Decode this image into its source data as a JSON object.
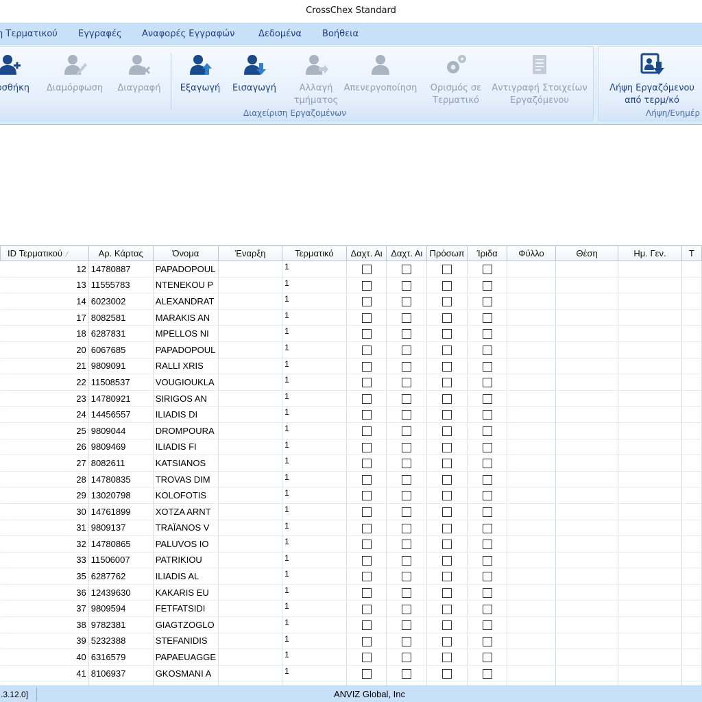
{
  "window": {
    "title": "CrossChex Standard"
  },
  "menu": [
    {
      "label": "η Τερματικού",
      "name": "menu-terminal"
    },
    {
      "label": "Εγγραφές",
      "name": "menu-records"
    },
    {
      "label": "Αναφορές Εγγραφών",
      "name": "menu-reports"
    },
    {
      "label": "Δεδομένα",
      "name": "menu-data"
    },
    {
      "label": "Βοήθεια",
      "name": "menu-help"
    }
  ],
  "ribbon": {
    "employee_group": {
      "label": "Διαχείριση Εργαζομένων",
      "buttons": {
        "add": {
          "label": "οσθήκη",
          "icon": "add-user-icon"
        },
        "modify": {
          "label": "Διαμόρφωση",
          "icon": "edit-user-icon"
        },
        "delete": {
          "label": "Διαγραφή",
          "icon": "delete-user-icon"
        },
        "export": {
          "label": "Εξαγωγή",
          "icon": "export-user-icon"
        },
        "import": {
          "label": "Εισαγωγή",
          "icon": "import-user-icon"
        },
        "change_dept": {
          "line1": "Αλλαγή",
          "line2": "τμήματος",
          "icon": "change-department-icon"
        },
        "deactivate": {
          "label": "Απενεργοποίηση",
          "icon": "deactivate-user-icon"
        },
        "set_terminal": {
          "line1": "Ορισμός σε",
          "line2": "Τερματικό",
          "icon": "gears-icon"
        },
        "copy_data": {
          "line1": "Αντιγραφή Στοιχείων",
          "line2": "Εργαζόμενου",
          "icon": "copy-document-icon"
        }
      }
    },
    "download_group": {
      "label": "Λήψη/Ενημέρ",
      "buttons": {
        "download_employee": {
          "line1": "Λήψη Εργαζόμενου",
          "line2": "από τερμ/κό",
          "icon": "download-from-terminal-icon"
        }
      }
    }
  },
  "colors": {
    "menubar_bg": "#c9e1f8",
    "ribbon_active_icon": "#1b4a8c",
    "ribbon_disabled_icon": "#a9b4c1",
    "statusbar_bg": "#c9e1f8"
  },
  "table": {
    "columns": [
      "ID Τερματικού",
      "Αρ. Κάρτας",
      "Όνομα",
      "Έναρξη",
      "Τερματικό",
      "Δαχτ. Αι",
      "Δαχτ. Αι",
      "Πρόσωπ",
      "Ίριδα",
      "Φύλλο",
      "Θέση",
      "Ημ. Γεν.",
      "Τ"
    ],
    "rows": [
      {
        "id": "12",
        "card": "14780887",
        "name": "PAPADOPOUL",
        "start": "",
        "terminal": "1"
      },
      {
        "id": "13",
        "card": "11555783",
        "name": "NTENEKOU P",
        "start": "",
        "terminal": "1"
      },
      {
        "id": "14",
        "card": "6023002",
        "name": "ALEXANDRAT",
        "start": "",
        "terminal": "1"
      },
      {
        "id": "17",
        "card": "8082581",
        "name": "MARAKIS AN",
        "start": "",
        "terminal": "1"
      },
      {
        "id": "18",
        "card": "6287831",
        "name": "MPELLOS NI",
        "start": "",
        "terminal": "1"
      },
      {
        "id": "20",
        "card": "6067685",
        "name": "PAPADOPOUL",
        "start": "",
        "terminal": "1"
      },
      {
        "id": "21",
        "card": "9809091",
        "name": "RALLI XRIS",
        "start": "",
        "terminal": "1"
      },
      {
        "id": "22",
        "card": "11508537",
        "name": "VOUGIOUKLA",
        "start": "",
        "terminal": "1"
      },
      {
        "id": "23",
        "card": "14780921",
        "name": "SIRIGOS AN",
        "start": "",
        "terminal": "1"
      },
      {
        "id": "24",
        "card": "14456557",
        "name": "ILIADIS DI",
        "start": "",
        "terminal": "1"
      },
      {
        "id": "25",
        "card": "9809044",
        "name": "DROMPOURA",
        "start": "",
        "terminal": "1"
      },
      {
        "id": "26",
        "card": "9809469",
        "name": "ILIADIS FI",
        "start": "",
        "terminal": "1"
      },
      {
        "id": "27",
        "card": "8082611",
        "name": "KATSIANOS",
        "start": "",
        "terminal": "1"
      },
      {
        "id": "28",
        "card": "14780835",
        "name": "TROVAS DIM",
        "start": "",
        "terminal": "1"
      },
      {
        "id": "29",
        "card": "13020798",
        "name": "KOLOFOTIS",
        "start": "",
        "terminal": "1"
      },
      {
        "id": "30",
        "card": "14761899",
        "name": "XOTZA ARNT",
        "start": "",
        "terminal": "1"
      },
      {
        "id": "31",
        "card": "9809137",
        "name": "TRAÏANOS V",
        "start": "",
        "terminal": "1"
      },
      {
        "id": "32",
        "card": "14780865",
        "name": "PALUVOS IO",
        "start": "",
        "terminal": "1"
      },
      {
        "id": "33",
        "card": "11506007",
        "name": "PATRIKIOU",
        "start": "",
        "terminal": "1"
      },
      {
        "id": "35",
        "card": "6287762",
        "name": "ILIADIS AL",
        "start": "",
        "terminal": "1"
      },
      {
        "id": "36",
        "card": "12439630",
        "name": "KAKARIS EU",
        "start": "",
        "terminal": "1"
      },
      {
        "id": "37",
        "card": "9809594",
        "name": "FETFATSIDI",
        "start": "",
        "terminal": "1"
      },
      {
        "id": "38",
        "card": "9782381",
        "name": "GIAGTZOGLO",
        "start": "",
        "terminal": "1"
      },
      {
        "id": "39",
        "card": "5232388",
        "name": "STEFANIDIS",
        "start": "",
        "terminal": "1"
      },
      {
        "id": "40",
        "card": "6316579",
        "name": "PAPAEUAGGE",
        "start": "",
        "terminal": "1"
      },
      {
        "id": "41",
        "card": "8106937",
        "name": "GKOSMANI A",
        "start": "",
        "terminal": "1"
      },
      {
        "id": "",
        "card": "",
        "name": "",
        "start": "",
        "terminal": ""
      }
    ]
  },
  "status": {
    "version": ".3.12.0]",
    "company": "ANVIZ Global, Inc"
  }
}
